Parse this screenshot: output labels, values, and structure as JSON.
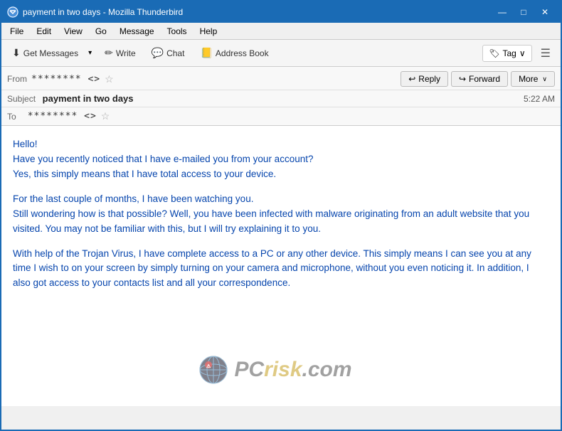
{
  "window": {
    "title": "payment in two days - Mozilla Thunderbird"
  },
  "titlebar": {
    "title": "payment in two days - Mozilla Thunderbird",
    "minimize": "—",
    "maximize": "□",
    "close": "✕"
  },
  "menubar": {
    "items": [
      "File",
      "Edit",
      "View",
      "Go",
      "Message",
      "Tools",
      "Help"
    ]
  },
  "toolbar": {
    "get_messages": "Get Messages",
    "write": "Write",
    "chat": "Chat",
    "address_book": "Address Book",
    "tag": "Tag",
    "tag_arrow": "∨"
  },
  "email_actions": {
    "reply": "Reply",
    "forward": "Forward",
    "more": "More",
    "more_arrow": "∨"
  },
  "email_header": {
    "from_label": "From",
    "from_value": "******** <>",
    "subject_label": "Subject",
    "subject_value": "payment in two days",
    "time": "5:22 AM",
    "to_label": "To",
    "to_value": "******** <>"
  },
  "email_body": {
    "paragraphs": [
      "Hello!\nHave you recently noticed that I have e-mailed you from your account?\nYes, this simply means that I have total access to your device.",
      "For the last couple of months, I have been watching you.\nStill wondering how is that possible? Well, you have been infected with malware originating from an adult website that you visited. You may not be familiar with this, but I will try explaining it to you.",
      "With help of the Trojan Virus, I have complete access to a PC or any other device. This simply means I can see you at any time I wish to on your screen by simply turning on your camera and microphone, without you even noticing it. In addition, I also got access to your contacts list and all your correspondence."
    ]
  },
  "watermark": {
    "text": "PCrisk.com"
  }
}
